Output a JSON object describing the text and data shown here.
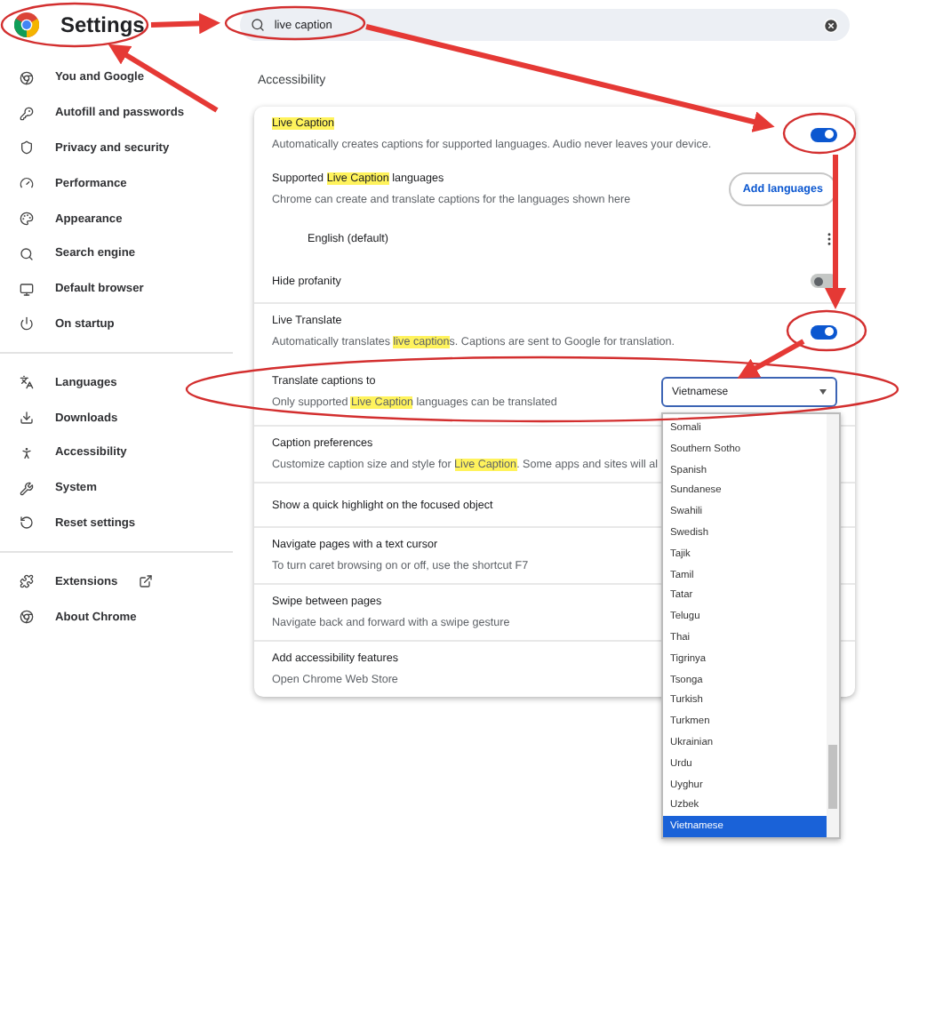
{
  "header": {
    "title": "Settings",
    "search": {
      "value": "live caption"
    }
  },
  "sidebar": {
    "groups": [
      [
        {
          "label": "You and Google",
          "selected": false,
          "external": false
        },
        {
          "label": "Autofill and passwords",
          "selected": false,
          "external": false
        },
        {
          "label": "Privacy and security",
          "selected": false,
          "external": false
        },
        {
          "label": "Performance",
          "selected": false,
          "external": false
        },
        {
          "label": "Appearance",
          "selected": false,
          "external": false
        },
        {
          "label": "Search engine",
          "selected": false,
          "external": false
        },
        {
          "label": "Default browser",
          "selected": false,
          "external": false
        },
        {
          "label": "On startup",
          "selected": false,
          "external": false
        }
      ],
      [
        {
          "label": "Languages",
          "selected": false,
          "external": false
        },
        {
          "label": "Downloads",
          "selected": false,
          "external": false
        },
        {
          "label": "Accessibility",
          "selected": false,
          "external": false
        },
        {
          "label": "System",
          "selected": false,
          "external": false
        },
        {
          "label": "Reset settings",
          "selected": false,
          "external": false
        }
      ],
      [
        {
          "label": "Extensions",
          "selected": false,
          "external": true
        },
        {
          "label": "About Chrome",
          "selected": false,
          "external": false
        }
      ]
    ]
  },
  "main": {
    "section_title": "Accessibility",
    "groups": [
      [
        {
          "kind": "toggle",
          "title": [
            {
              "text": "Live Caption",
              "highlight": true
            }
          ],
          "description": [
            {
              "text": "Automatically creates captions for supported languages. Audio never leaves your device.",
              "highlight": false
            }
          ],
          "on": true
        },
        {
          "kind": "button",
          "title": [
            {
              "text": "Supported ",
              "highlight": false
            },
            {
              "text": "Live Caption",
              "highlight": true
            },
            {
              "text": " languages",
              "highlight": false
            }
          ],
          "description": [
            {
              "text": "Chrome can create and translate captions for the languages shown here",
              "highlight": false
            }
          ],
          "button": "Add languages"
        },
        {
          "kind": "language",
          "title": [
            {
              "text": "English (default)",
              "highlight": false
            }
          ]
        },
        {
          "kind": "toggle",
          "title": [
            {
              "text": "Hide profanity",
              "highlight": false
            }
          ],
          "on": false
        }
      ],
      [
        {
          "kind": "toggle",
          "title": [
            {
              "text": "Live Translate",
              "highlight": false
            }
          ],
          "description": [
            {
              "text": "Automatically translates ",
              "highlight": false
            },
            {
              "text": "live caption",
              "highlight": true
            },
            {
              "text": "s. Captions are sent to Google for translation.",
              "highlight": false
            }
          ],
          "on": true
        },
        {
          "kind": "select",
          "title": [
            {
              "text": "Translate captions to",
              "highlight": false
            }
          ],
          "description": [
            {
              "text": "Only supported ",
              "highlight": false
            },
            {
              "text": "Live Caption",
              "highlight": true
            },
            {
              "text": " languages can be translated",
              "highlight": false
            }
          ],
          "value": "Vietnamese",
          "open": true,
          "options": [
            {
              "label": "Somali",
              "selected": false
            },
            {
              "label": "Southern Sotho",
              "selected": false
            },
            {
              "label": "Spanish",
              "selected": false
            },
            {
              "label": "Sundanese",
              "selected": false
            },
            {
              "label": "Swahili",
              "selected": false
            },
            {
              "label": "Swedish",
              "selected": false
            },
            {
              "label": "Tajik",
              "selected": false
            },
            {
              "label": "Tamil",
              "selected": false
            },
            {
              "label": "Tatar",
              "selected": false
            },
            {
              "label": "Telugu",
              "selected": false
            },
            {
              "label": "Thai",
              "selected": false
            },
            {
              "label": "Tigrinya",
              "selected": false
            },
            {
              "label": "Tsonga",
              "selected": false
            },
            {
              "label": "Turkish",
              "selected": false
            },
            {
              "label": "Turkmen",
              "selected": false
            },
            {
              "label": "Ukrainian",
              "selected": false
            },
            {
              "label": "Urdu",
              "selected": false
            },
            {
              "label": "Uyghur",
              "selected": false
            },
            {
              "label": "Uzbek",
              "selected": false
            },
            {
              "label": "Vietnamese",
              "selected": true
            }
          ]
        }
      ],
      [
        {
          "kind": "plain",
          "title": [
            {
              "text": "Caption preferences",
              "highlight": false
            }
          ],
          "description": [
            {
              "text": "Customize caption size and style for ",
              "highlight": false
            },
            {
              "text": "Live Caption",
              "highlight": true
            },
            {
              "text": ". Some apps and sites will al",
              "highlight": false
            }
          ]
        }
      ],
      [
        {
          "kind": "plain",
          "title": [
            {
              "text": "Show a quick highlight on the focused object",
              "highlight": false
            }
          ]
        }
      ],
      [
        {
          "kind": "plain",
          "title": [
            {
              "text": "Navigate pages with a text cursor",
              "highlight": false
            }
          ],
          "description": [
            {
              "text": "To turn caret browsing on or off, use the shortcut F7",
              "highlight": false
            }
          ]
        }
      ],
      [
        {
          "kind": "plain",
          "title": [
            {
              "text": "Swipe between pages",
              "highlight": false
            }
          ],
          "description": [
            {
              "text": "Navigate back and forward with a swipe gesture",
              "highlight": false
            }
          ]
        }
      ],
      [
        {
          "kind": "plain",
          "title": [
            {
              "text": "Add accessibility features",
              "highlight": false
            }
          ],
          "description": [
            {
              "text": "Open Chrome Web Store",
              "highlight": false
            }
          ]
        }
      ]
    ]
  }
}
